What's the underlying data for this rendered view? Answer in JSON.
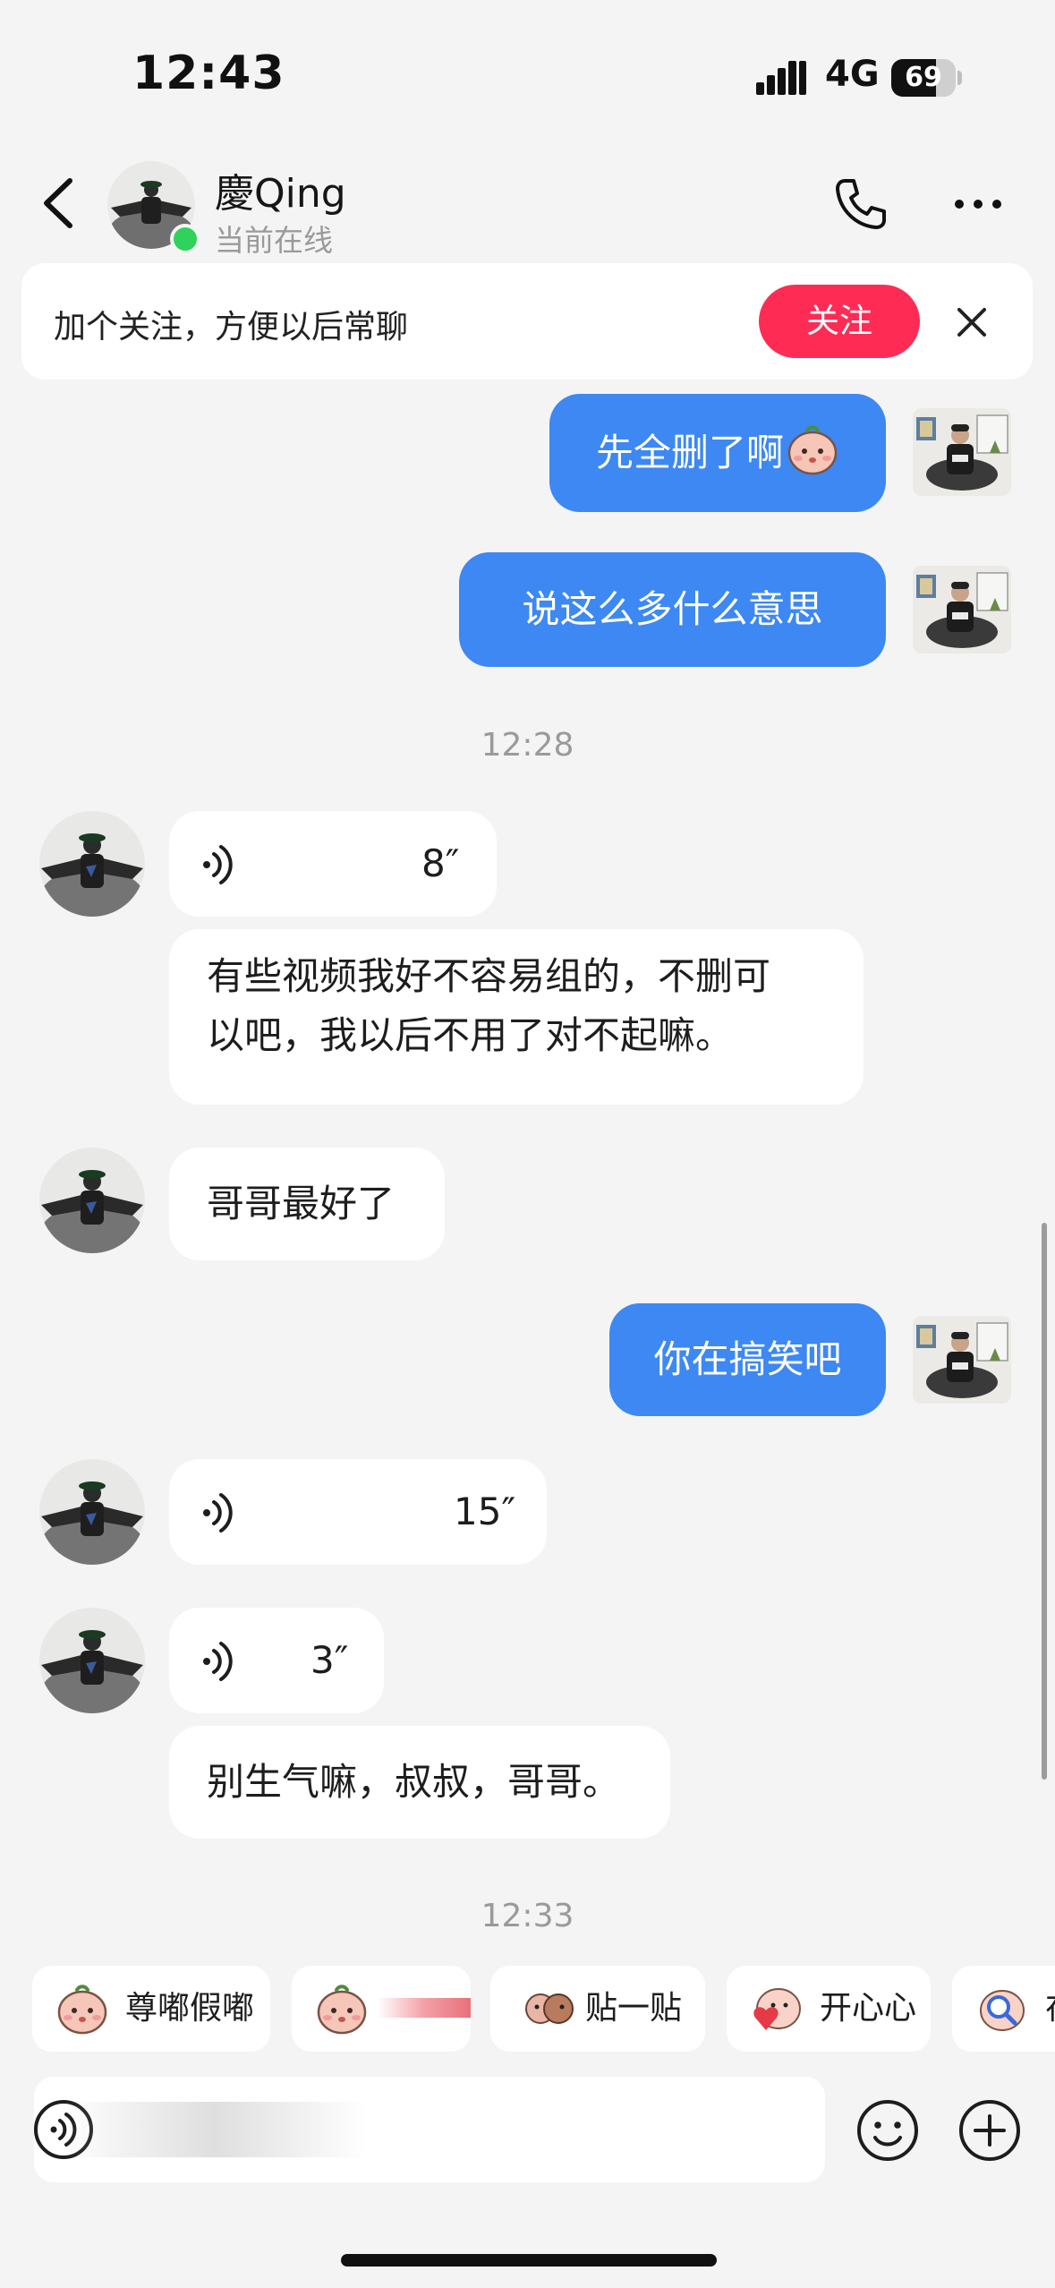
{
  "status_bar": {
    "time": "12:43",
    "network": "4G",
    "battery": "69",
    "battery_level": 0.69
  },
  "header": {
    "name": "慶Qing",
    "presence": "当前在线"
  },
  "banner": {
    "text": "加个关注，方便以后常聊",
    "follow_label": "关注"
  },
  "messages": {
    "m1": "先全删了啊",
    "m2": "说这么多什么意思",
    "ts1": "12:28",
    "v1": "8″",
    "m3_line1": "有些视频我好不容易组的，不删可",
    "m3_line2": "以吧，我以后不用了对不起嘛。",
    "m4": "哥哥最好了",
    "m5": "你在搞笑吧",
    "v2": "15″",
    "v3": "3″",
    "m6": "别生气嘛，叔叔，哥哥。",
    "ts2": "12:33"
  },
  "sticker_bar": {
    "chip1": "尊嘟假嘟",
    "chip3": "贴一贴",
    "chip4": "开心心",
    "chip5": "在"
  },
  "colors": {
    "outgoing_bubble": "#3d88f3",
    "follow_button": "#fe2c55",
    "online_dot": "#2fd35c"
  }
}
